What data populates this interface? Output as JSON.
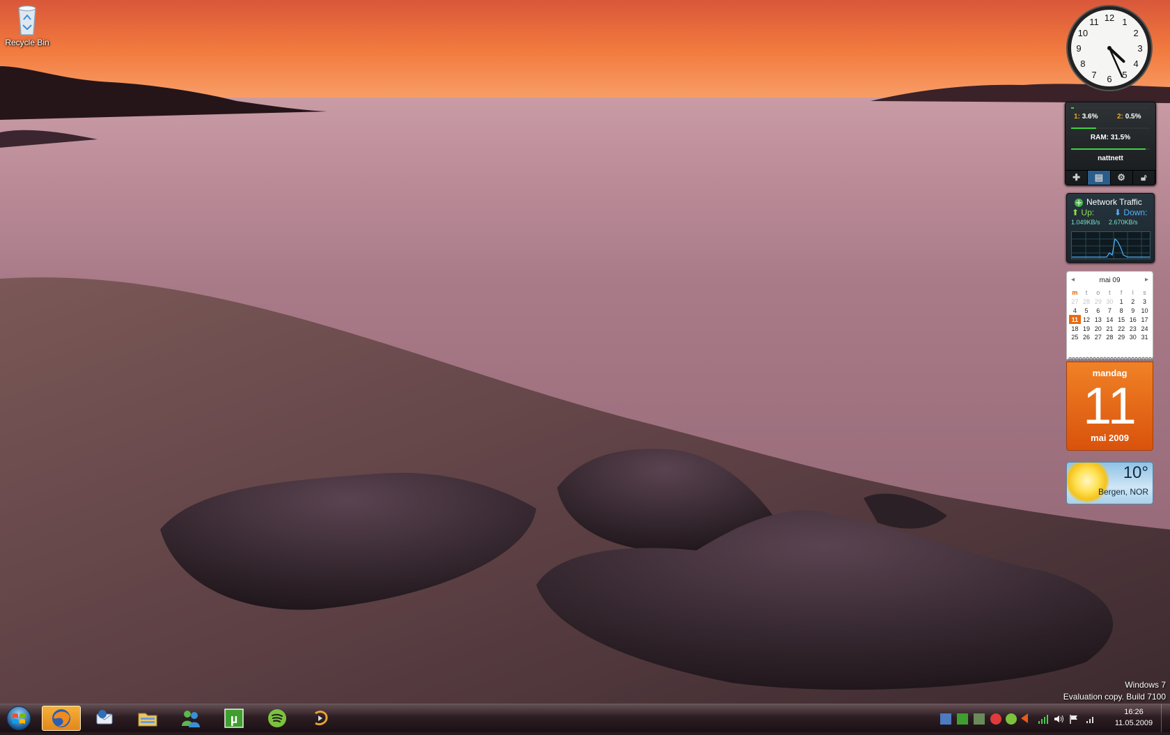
{
  "desktop": {
    "icons": [
      {
        "label": "Recycle Bin",
        "icon": "recycle-bin-icon"
      }
    ],
    "watermark": {
      "line1": "Windows 7",
      "line2": "Evaluation copy. Build 7100"
    }
  },
  "gadgets": {
    "clock": {
      "hour": 4,
      "minute": 26
    },
    "cpu_meter": {
      "core1_label": "1:",
      "core1_value": "3.6%",
      "core2_label": "2:",
      "core2_value": "0.5%",
      "ram": "RAM: 31.5%",
      "network": "nattnett",
      "core1_fraction": 0.036,
      "ram_fraction": 0.315,
      "network_fraction": 0.95
    },
    "network_traffic": {
      "title": "Network Traffic",
      "up_label": "Up:",
      "down_label": "Down:",
      "up_value": "1.049KB/s",
      "down_value": "2.670KB/s"
    },
    "calendar": {
      "month_title": "mai 09",
      "weekdays": [
        "m",
        "t",
        "o",
        "t",
        "f",
        "l",
        "s"
      ],
      "weeks": [
        [
          "27",
          "28",
          "29",
          "30",
          "1",
          "2",
          "3"
        ],
        [
          "4",
          "5",
          "6",
          "7",
          "8",
          "9",
          "10"
        ],
        [
          "11",
          "12",
          "13",
          "14",
          "15",
          "16",
          "17"
        ],
        [
          "18",
          "19",
          "20",
          "21",
          "22",
          "23",
          "24"
        ],
        [
          "25",
          "26",
          "27",
          "28",
          "29",
          "30",
          "31"
        ]
      ],
      "today": "11",
      "weekday_name": "mandag",
      "day_number": "11",
      "month_year": "mai 2009"
    },
    "weather": {
      "temperature": "10°",
      "location": "Bergen, NOR"
    }
  },
  "taskbar": {
    "apps": [
      {
        "name": "firefox",
        "icon": "firefox-icon",
        "active": true
      },
      {
        "name": "thunderbird",
        "icon": "thunderbird-icon",
        "active": false
      },
      {
        "name": "explorer",
        "icon": "folder-icon",
        "active": false
      },
      {
        "name": "messenger",
        "icon": "messenger-icon",
        "active": false
      },
      {
        "name": "utorrent",
        "icon": "utorrent-icon",
        "active": false
      },
      {
        "name": "spotify",
        "icon": "spotify-icon",
        "active": false
      },
      {
        "name": "winamp",
        "icon": "winamp-icon",
        "active": false
      }
    ],
    "clock_time": "16:26",
    "clock_date": "11.05.2009"
  },
  "colors": {
    "accent_orange": "#e86a12",
    "cpu_green": "#3fd33f",
    "taskbar": "#2d1e23"
  }
}
